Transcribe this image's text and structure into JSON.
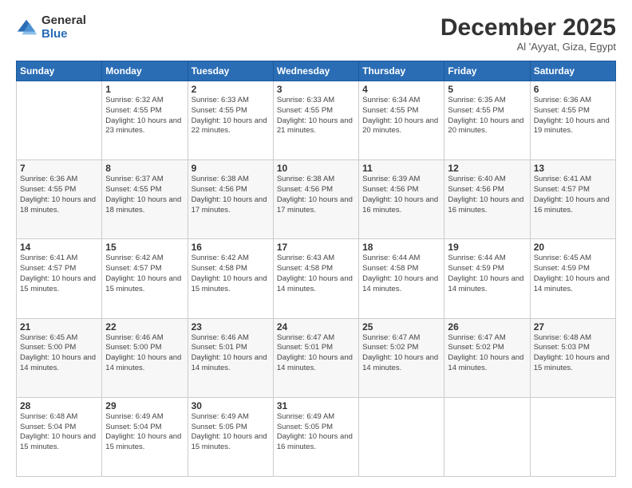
{
  "logo": {
    "general": "General",
    "blue": "Blue"
  },
  "header": {
    "month": "December 2025",
    "location": "Al 'Ayyat, Giza, Egypt"
  },
  "weekdays": [
    "Sunday",
    "Monday",
    "Tuesday",
    "Wednesday",
    "Thursday",
    "Friday",
    "Saturday"
  ],
  "weeks": [
    [
      {
        "day": "",
        "sunrise": "",
        "sunset": "",
        "daylight": ""
      },
      {
        "day": "1",
        "sunrise": "Sunrise: 6:32 AM",
        "sunset": "Sunset: 4:55 PM",
        "daylight": "Daylight: 10 hours and 23 minutes."
      },
      {
        "day": "2",
        "sunrise": "Sunrise: 6:33 AM",
        "sunset": "Sunset: 4:55 PM",
        "daylight": "Daylight: 10 hours and 22 minutes."
      },
      {
        "day": "3",
        "sunrise": "Sunrise: 6:33 AM",
        "sunset": "Sunset: 4:55 PM",
        "daylight": "Daylight: 10 hours and 21 minutes."
      },
      {
        "day": "4",
        "sunrise": "Sunrise: 6:34 AM",
        "sunset": "Sunset: 4:55 PM",
        "daylight": "Daylight: 10 hours and 20 minutes."
      },
      {
        "day": "5",
        "sunrise": "Sunrise: 6:35 AM",
        "sunset": "Sunset: 4:55 PM",
        "daylight": "Daylight: 10 hours and 20 minutes."
      },
      {
        "day": "6",
        "sunrise": "Sunrise: 6:36 AM",
        "sunset": "Sunset: 4:55 PM",
        "daylight": "Daylight: 10 hours and 19 minutes."
      }
    ],
    [
      {
        "day": "7",
        "sunrise": "Sunrise: 6:36 AM",
        "sunset": "Sunset: 4:55 PM",
        "daylight": "Daylight: 10 hours and 18 minutes."
      },
      {
        "day": "8",
        "sunrise": "Sunrise: 6:37 AM",
        "sunset": "Sunset: 4:55 PM",
        "daylight": "Daylight: 10 hours and 18 minutes."
      },
      {
        "day": "9",
        "sunrise": "Sunrise: 6:38 AM",
        "sunset": "Sunset: 4:56 PM",
        "daylight": "Daylight: 10 hours and 17 minutes."
      },
      {
        "day": "10",
        "sunrise": "Sunrise: 6:38 AM",
        "sunset": "Sunset: 4:56 PM",
        "daylight": "Daylight: 10 hours and 17 minutes."
      },
      {
        "day": "11",
        "sunrise": "Sunrise: 6:39 AM",
        "sunset": "Sunset: 4:56 PM",
        "daylight": "Daylight: 10 hours and 16 minutes."
      },
      {
        "day": "12",
        "sunrise": "Sunrise: 6:40 AM",
        "sunset": "Sunset: 4:56 PM",
        "daylight": "Daylight: 10 hours and 16 minutes."
      },
      {
        "day": "13",
        "sunrise": "Sunrise: 6:41 AM",
        "sunset": "Sunset: 4:57 PM",
        "daylight": "Daylight: 10 hours and 16 minutes."
      }
    ],
    [
      {
        "day": "14",
        "sunrise": "Sunrise: 6:41 AM",
        "sunset": "Sunset: 4:57 PM",
        "daylight": "Daylight: 10 hours and 15 minutes."
      },
      {
        "day": "15",
        "sunrise": "Sunrise: 6:42 AM",
        "sunset": "Sunset: 4:57 PM",
        "daylight": "Daylight: 10 hours and 15 minutes."
      },
      {
        "day": "16",
        "sunrise": "Sunrise: 6:42 AM",
        "sunset": "Sunset: 4:58 PM",
        "daylight": "Daylight: 10 hours and 15 minutes."
      },
      {
        "day": "17",
        "sunrise": "Sunrise: 6:43 AM",
        "sunset": "Sunset: 4:58 PM",
        "daylight": "Daylight: 10 hours and 14 minutes."
      },
      {
        "day": "18",
        "sunrise": "Sunrise: 6:44 AM",
        "sunset": "Sunset: 4:58 PM",
        "daylight": "Daylight: 10 hours and 14 minutes."
      },
      {
        "day": "19",
        "sunrise": "Sunrise: 6:44 AM",
        "sunset": "Sunset: 4:59 PM",
        "daylight": "Daylight: 10 hours and 14 minutes."
      },
      {
        "day": "20",
        "sunrise": "Sunrise: 6:45 AM",
        "sunset": "Sunset: 4:59 PM",
        "daylight": "Daylight: 10 hours and 14 minutes."
      }
    ],
    [
      {
        "day": "21",
        "sunrise": "Sunrise: 6:45 AM",
        "sunset": "Sunset: 5:00 PM",
        "daylight": "Daylight: 10 hours and 14 minutes."
      },
      {
        "day": "22",
        "sunrise": "Sunrise: 6:46 AM",
        "sunset": "Sunset: 5:00 PM",
        "daylight": "Daylight: 10 hours and 14 minutes."
      },
      {
        "day": "23",
        "sunrise": "Sunrise: 6:46 AM",
        "sunset": "Sunset: 5:01 PM",
        "daylight": "Daylight: 10 hours and 14 minutes."
      },
      {
        "day": "24",
        "sunrise": "Sunrise: 6:47 AM",
        "sunset": "Sunset: 5:01 PM",
        "daylight": "Daylight: 10 hours and 14 minutes."
      },
      {
        "day": "25",
        "sunrise": "Sunrise: 6:47 AM",
        "sunset": "Sunset: 5:02 PM",
        "daylight": "Daylight: 10 hours and 14 minutes."
      },
      {
        "day": "26",
        "sunrise": "Sunrise: 6:47 AM",
        "sunset": "Sunset: 5:02 PM",
        "daylight": "Daylight: 10 hours and 14 minutes."
      },
      {
        "day": "27",
        "sunrise": "Sunrise: 6:48 AM",
        "sunset": "Sunset: 5:03 PM",
        "daylight": "Daylight: 10 hours and 15 minutes."
      }
    ],
    [
      {
        "day": "28",
        "sunrise": "Sunrise: 6:48 AM",
        "sunset": "Sunset: 5:04 PM",
        "daylight": "Daylight: 10 hours and 15 minutes."
      },
      {
        "day": "29",
        "sunrise": "Sunrise: 6:49 AM",
        "sunset": "Sunset: 5:04 PM",
        "daylight": "Daylight: 10 hours and 15 minutes."
      },
      {
        "day": "30",
        "sunrise": "Sunrise: 6:49 AM",
        "sunset": "Sunset: 5:05 PM",
        "daylight": "Daylight: 10 hours and 15 minutes."
      },
      {
        "day": "31",
        "sunrise": "Sunrise: 6:49 AM",
        "sunset": "Sunset: 5:05 PM",
        "daylight": "Daylight: 10 hours and 16 minutes."
      },
      {
        "day": "",
        "sunrise": "",
        "sunset": "",
        "daylight": ""
      },
      {
        "day": "",
        "sunrise": "",
        "sunset": "",
        "daylight": ""
      },
      {
        "day": "",
        "sunrise": "",
        "sunset": "",
        "daylight": ""
      }
    ]
  ]
}
